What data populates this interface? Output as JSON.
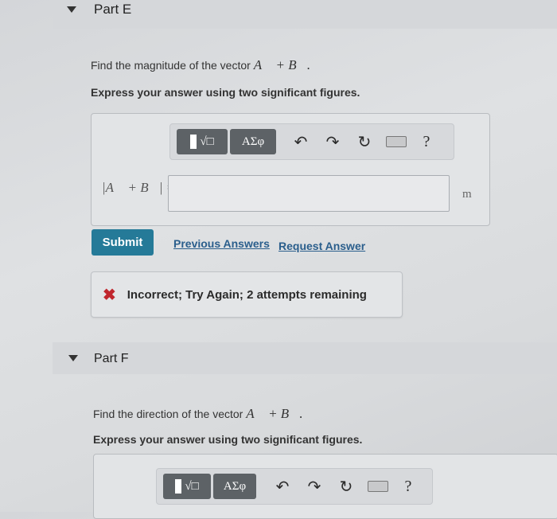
{
  "partE": {
    "label": "Part E",
    "prompt_prefix": "Find the magnitude of the vector ",
    "prompt_math": "A⃗ + B⃗.",
    "instruction": "Express your answer using two significant figures.",
    "toolbar": {
      "template_btn": "√□",
      "greek_btn": "ΑΣφ",
      "help": "?"
    },
    "eq_label": "|A⃗ + B⃗| =",
    "input_value": "",
    "unit": "m",
    "submit": "Submit",
    "previous_answers": "Previous Answers",
    "request_answer": "Request Answer",
    "feedback": "Incorrect; Try Again; 2 attempts remaining"
  },
  "partF": {
    "label": "Part F",
    "prompt_prefix": "Find the direction of the vector ",
    "prompt_math": "A⃗ + B⃗.",
    "instruction": "Express your answer using two significant figures.",
    "toolbar": {
      "template_btn": "√□",
      "greek_btn": "ΑΣφ",
      "help": "?"
    }
  },
  "colors": {
    "submit": "#257a98",
    "error": "#c0262d",
    "link": "#2a5e8c"
  }
}
